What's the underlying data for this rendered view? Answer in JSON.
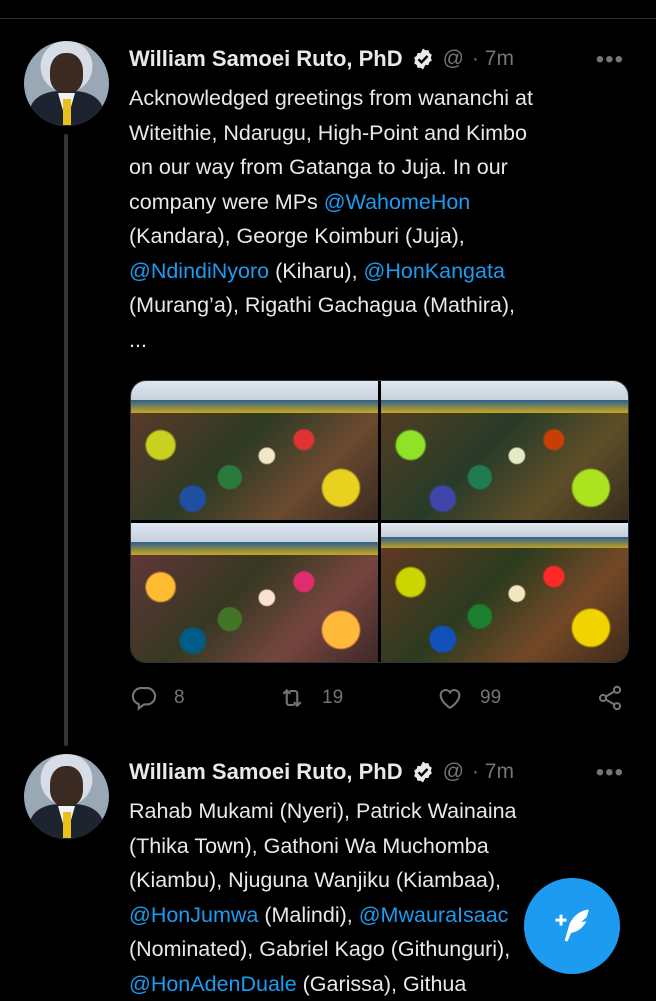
{
  "tweets": [
    {
      "author": "William Samoei Ruto, PhD",
      "handle": "@",
      "time": "· 7m",
      "more": "•••",
      "lines": [
        [
          {
            "t": "Acknowledged greetings from wananchi at",
            "m": false
          }
        ],
        [
          {
            "t": "Witeithie, Ndarugu, High-Point and Kimbo",
            "m": false
          }
        ],
        [
          {
            "t": "on our way from Gatanga to Juja. In our",
            "m": false
          }
        ],
        [
          {
            "t": "company were MPs ",
            "m": false
          },
          {
            "t": "@WahomeHon",
            "m": true
          }
        ],
        [
          {
            "t": "(Kandara), George Koimburi (Juja),",
            "m": false
          }
        ],
        [
          {
            "t": "@NdindiNyoro",
            "m": true
          },
          {
            "t": " (Kiharu), ",
            "m": false
          },
          {
            "t": "@HonKangata",
            "m": true
          }
        ],
        [
          {
            "t": " (Murang’a), Rigathi Gachagua (Mathira),",
            "m": false
          }
        ],
        [
          {
            "t": "...",
            "m": false
          }
        ]
      ],
      "stats": {
        "replies": "8",
        "retweets": "19",
        "likes": "99"
      }
    },
    {
      "author": "William Samoei Ruto, PhD",
      "handle": "@",
      "time": "· 7m",
      "more": "•••",
      "lines": [
        [
          {
            "t": "Rahab Mukami (Nyeri), Patrick Wainaina",
            "m": false
          }
        ],
        [
          {
            "t": "(Thika Town), Gathoni Wa Muchomba",
            "m": false
          }
        ],
        [
          {
            "t": "(Kiambu), Njuguna Wanjiku (Kiambaa),",
            "m": false
          }
        ],
        [
          {
            "t": "@HonJumwa",
            "m": true
          },
          {
            "t": " (Malindi), ",
            "m": false
          },
          {
            "t": "@MwauraIsaac",
            "m": true
          }
        ],
        [
          {
            "t": "(Nominated), Gabriel Kago (Githunguri),",
            "m": false
          }
        ],
        [
          {
            "t": "@HonAdenDuale",
            "m": true
          },
          {
            "t": " (Garissa), Githua",
            "m": false
          }
        ]
      ]
    }
  ],
  "icons": {
    "reply": "reply-icon",
    "retweet": "retweet-icon",
    "like": "heart-icon",
    "share": "share-icon",
    "verified": "verified-badge-icon",
    "compose": "compose-tweet-icon"
  },
  "colors": {
    "accent": "#1d9bf0",
    "text": "#e7e9ea",
    "muted": "#71767b",
    "background": "#000000"
  }
}
